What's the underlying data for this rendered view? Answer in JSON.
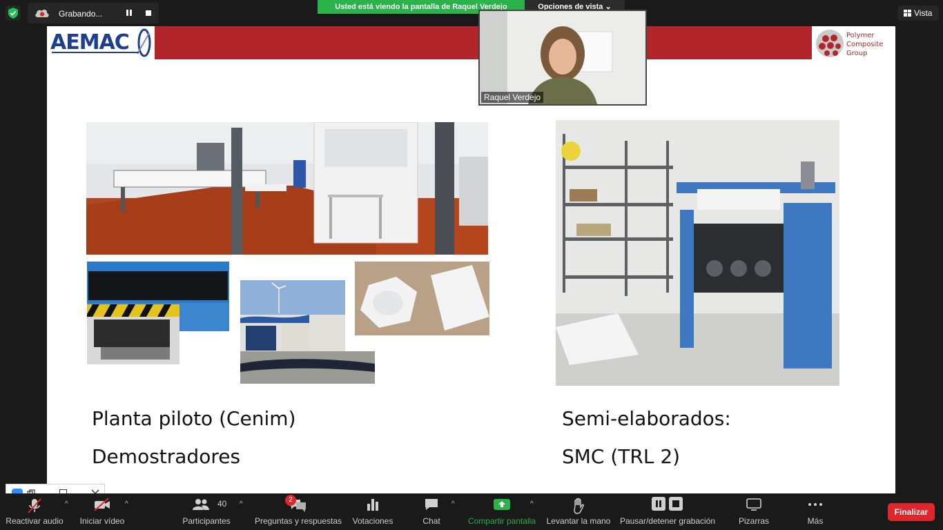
{
  "topbar": {
    "recording_label": "Grabando...",
    "share_banner": "Usted está viendo la pantalla de  Raquel Verdejo",
    "view_options": "Opciones de vista",
    "view_button": "Vista"
  },
  "participant": {
    "name": "Raquel Verdejo"
  },
  "slide": {
    "left_caption_1": "Planta piloto (Cenim)",
    "left_caption_2": "Demostradores",
    "right_caption_1": "Semi-elaborados:",
    "right_caption_2": "SMC (TRL 2)",
    "logo_right_lines": [
      "Polymer",
      "Composite",
      "Group"
    ]
  },
  "toolbar": {
    "audio": "Reactivar audio",
    "video": "Iniciar vídeo",
    "participants": "Participantes",
    "participants_count": "40",
    "qa": "Preguntas y respuestas",
    "qa_badge": "2",
    "polls": "Votaciones",
    "chat": "Chat",
    "share": "Compartir pantalla",
    "raise_hand": "Levantar la mano",
    "pause_rec": "Pausar/detener grabación",
    "whiteboards": "Pizarras",
    "more": "Más",
    "end": "Finalizar"
  },
  "colors": {
    "share_green": "#29b34a",
    "slide_band": "#b2262b",
    "end_red": "#e0262a"
  }
}
